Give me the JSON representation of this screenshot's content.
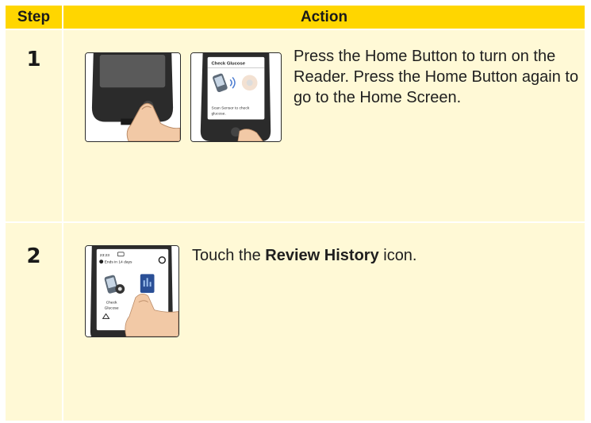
{
  "table": {
    "header": {
      "step": "Step",
      "action": "Action"
    },
    "rows": [
      {
        "number": "1",
        "text": "Press the Home Button to turn on the Reader. Press the Home Button again to go to the Home Screen.",
        "images": [
          {
            "screen_title": ""
          },
          {
            "screen_title": "Check Glucose",
            "screen_caption": "Scan Sensor to check glucose."
          }
        ]
      },
      {
        "number": "2",
        "text_before": "Touch the ",
        "text_bold": "Review History",
        "text_after": " icon.",
        "image": {
          "time": "23:23",
          "sensor_status": "Ends in 14 days",
          "icon_label": "Check Glucose"
        }
      }
    ]
  },
  "colors": {
    "header": "#ffd600",
    "row_bg": "#fff9d6"
  }
}
